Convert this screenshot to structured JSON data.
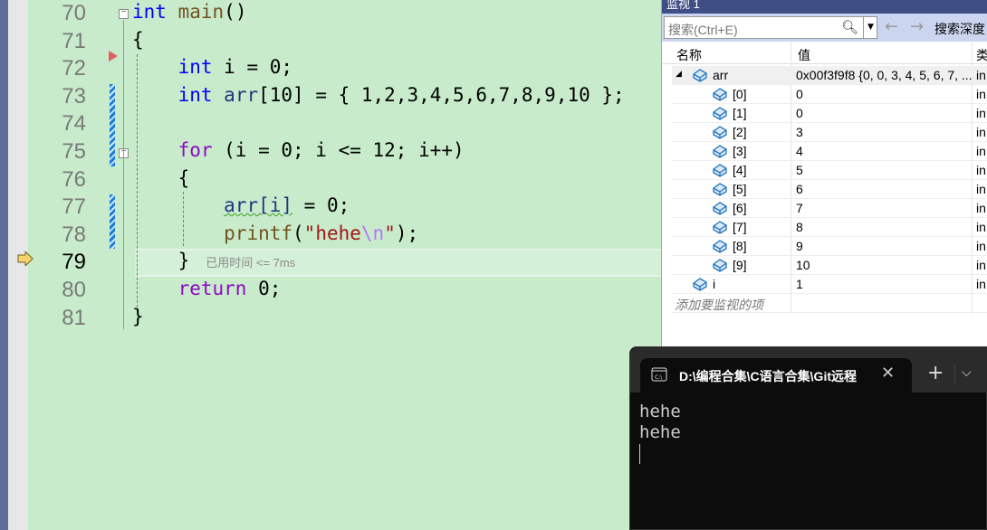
{
  "editor": {
    "current_line": 79,
    "lines": [
      {
        "n": "70",
        "tokens": [
          {
            "t": "int",
            "c": "kw"
          },
          {
            "t": " "
          },
          {
            "t": "main",
            "c": "fn"
          },
          {
            "t": "()"
          }
        ]
      },
      {
        "n": "71",
        "tokens": [
          {
            "t": "{"
          }
        ]
      },
      {
        "n": "72",
        "tokens": [
          {
            "t": "    "
          },
          {
            "t": "int",
            "c": "kw"
          },
          {
            "t": " i = 0;"
          }
        ]
      },
      {
        "n": "73",
        "tokens": [
          {
            "t": "    "
          },
          {
            "t": "int",
            "c": "kw"
          },
          {
            "t": " "
          },
          {
            "t": "arr",
            "c": "var"
          },
          {
            "t": "[10] = { 1,2,3,4,5,6,7,8,9,10 };"
          }
        ]
      },
      {
        "n": "74",
        "tokens": []
      },
      {
        "n": "75",
        "tokens": [
          {
            "t": "    "
          },
          {
            "t": "for",
            "c": "ctl"
          },
          {
            "t": " (i = 0; i <= 12; i++)"
          }
        ]
      },
      {
        "n": "76",
        "tokens": [
          {
            "t": "    {"
          }
        ]
      },
      {
        "n": "77",
        "tokens": [
          {
            "t": "        "
          },
          {
            "t": "arr[i]",
            "c": "var squig"
          },
          {
            "t": " = 0;"
          }
        ]
      },
      {
        "n": "78",
        "tokens": [
          {
            "t": "        "
          },
          {
            "t": "printf",
            "c": "fn"
          },
          {
            "t": "("
          },
          {
            "t": "\"hehe",
            "c": "str"
          },
          {
            "t": "\\n",
            "c": "esc"
          },
          {
            "t": "\"",
            "c": "str"
          },
          {
            "t": ");"
          }
        ]
      },
      {
        "n": "79",
        "tokens": [
          {
            "t": "    }"
          }
        ],
        "hint": "已用时间 <= 7ms"
      },
      {
        "n": "80",
        "tokens": [
          {
            "t": "    "
          },
          {
            "t": "return",
            "c": "ctl"
          },
          {
            "t": " 0;"
          }
        ]
      },
      {
        "n": "81",
        "tokens": [
          {
            "t": "}"
          }
        ]
      }
    ]
  },
  "watch": {
    "title": "监视 1",
    "search_placeholder": "搜索(Ctrl+E)",
    "search_depth_label": "搜索深度",
    "columns": {
      "name": "名称",
      "value": "值",
      "type": "类"
    },
    "rows": [
      {
        "name": "arr",
        "value": "0x00f3f9f8 {0, 0, 3, 4, 5, 6, 7, ...",
        "type": "in",
        "level": 0,
        "expanded": true
      },
      {
        "name": "[0]",
        "value": "0",
        "type": "in",
        "level": 1
      },
      {
        "name": "[1]",
        "value": "0",
        "type": "in",
        "level": 1
      },
      {
        "name": "[2]",
        "value": "3",
        "type": "in",
        "level": 1
      },
      {
        "name": "[3]",
        "value": "4",
        "type": "in",
        "level": 1
      },
      {
        "name": "[4]",
        "value": "5",
        "type": "in",
        "level": 1
      },
      {
        "name": "[5]",
        "value": "6",
        "type": "in",
        "level": 1
      },
      {
        "name": "[6]",
        "value": "7",
        "type": "in",
        "level": 1
      },
      {
        "name": "[7]",
        "value": "8",
        "type": "in",
        "level": 1
      },
      {
        "name": "[8]",
        "value": "9",
        "type": "in",
        "level": 1
      },
      {
        "name": "[9]",
        "value": "10",
        "type": "in",
        "level": 1
      },
      {
        "name": "i",
        "value": "1",
        "type": "in",
        "level": 0
      }
    ],
    "add_item_placeholder": "添加要监视的项"
  },
  "terminal": {
    "tab_title": "D:\\编程合集\\C语言合集\\Git远程",
    "output": "hehe\nhehe"
  }
}
